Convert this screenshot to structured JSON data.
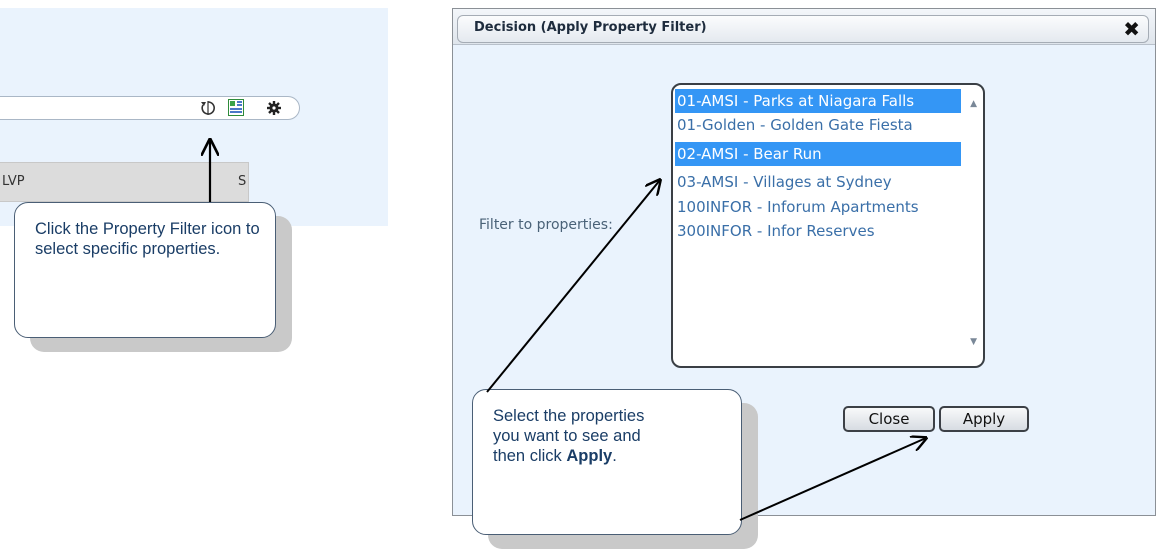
{
  "left": {
    "grid_columns": [
      "LVP",
      "S"
    ],
    "icons": [
      "refresh-icon",
      "property-filter-icon",
      "gear-icon"
    ],
    "callout_text": "Click the Property Filter icon to select specific properties."
  },
  "dialog": {
    "title": "Decision (Apply Property Filter)",
    "close_glyph": "✖",
    "filter_label": "Filter to properties:",
    "properties": [
      {
        "label": "01-AMSI - Parks at Niagara Falls",
        "selected": true
      },
      {
        "label": "01-Golden - Golden Gate Fiesta",
        "selected": false
      },
      {
        "label": "02-AMSI - Bear Run",
        "selected": true
      },
      {
        "label": "03-AMSI - Villages at Sydney",
        "selected": false
      },
      {
        "label": "100INFOR - Inforum Apartments",
        "selected": false
      },
      {
        "label": "300INFOR - Infor Reserves",
        "selected": false
      }
    ],
    "buttons": {
      "close": "Close",
      "apply": "Apply"
    }
  },
  "callout2": {
    "text_before": "Select the properties you want to see and then click ",
    "bold": "Apply",
    "text_after": "."
  },
  "colors": {
    "selection": "#3496f5",
    "panel_bg": "#eaf3fd",
    "callout_text": "#1a3d66"
  }
}
